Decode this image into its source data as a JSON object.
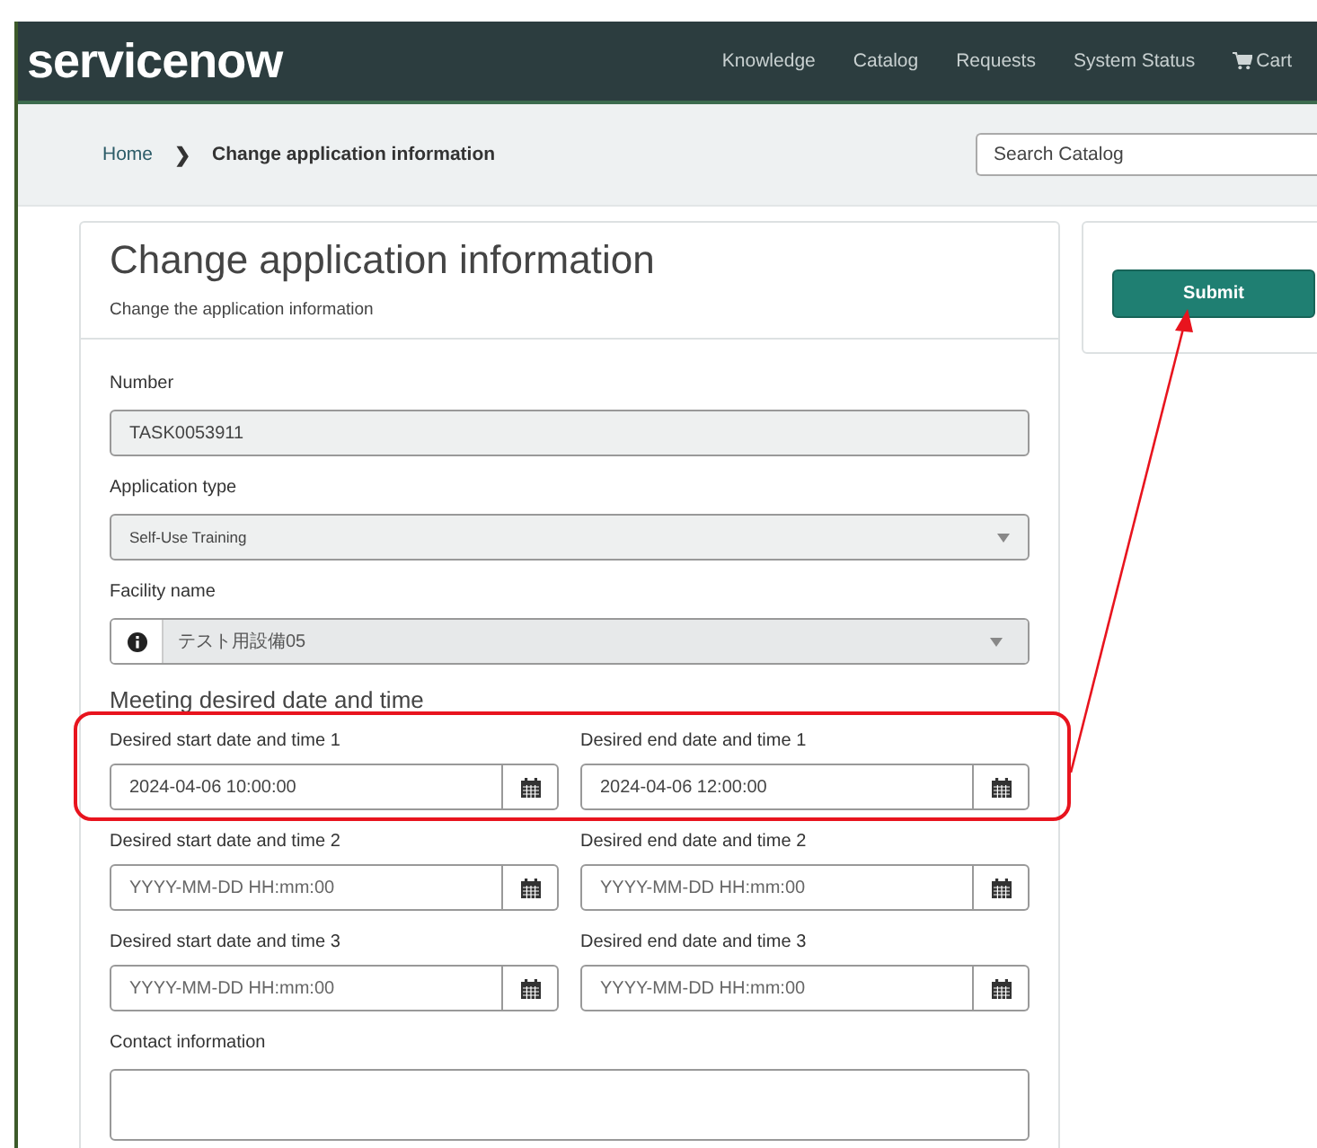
{
  "header": {
    "logo": "servicenow",
    "nav": [
      {
        "label": "Knowledge",
        "kind": "link"
      },
      {
        "label": "Catalog",
        "kind": "link"
      },
      {
        "label": "Requests",
        "kind": "link"
      },
      {
        "label": "System Status",
        "kind": "link"
      },
      {
        "label": "Cart",
        "kind": "cart"
      }
    ]
  },
  "breadcrumb": {
    "home": "Home",
    "separator": "❯",
    "current": "Change application information"
  },
  "search": {
    "placeholder": "Search Catalog"
  },
  "form": {
    "title": "Change application information",
    "subtitle": "Change the application information",
    "fields": [
      {
        "kind": "text",
        "label": "Number",
        "value": "TASK0053911",
        "disabled": true
      },
      {
        "kind": "select",
        "label": "Application type",
        "value": "Self-Use Training",
        "disabled": true
      },
      {
        "kind": "reference",
        "label": "Facility name",
        "value": "テスト用設備05",
        "disabled": true
      }
    ],
    "section": "Meeting desired date and time",
    "date_rows": [
      {
        "start": {
          "label": "Desired start date and time 1",
          "value": "2024-04-06 10:00:00"
        },
        "end": {
          "label": "Desired end date and time 1",
          "value": "2024-04-06 12:00:00"
        }
      },
      {
        "start": {
          "label": "Desired start date and time 2",
          "placeholder": "YYYY-MM-DD HH:mm:00"
        },
        "end": {
          "label": "Desired end date and time 2",
          "placeholder": "YYYY-MM-DD HH:mm:00"
        }
      },
      {
        "start": {
          "label": "Desired start date and time 3",
          "placeholder": "YYYY-MM-DD HH:mm:00"
        },
        "end": {
          "label": "Desired end date and time 3",
          "placeholder": "YYYY-MM-DD HH:mm:00"
        }
      }
    ],
    "contact": {
      "label": "Contact information"
    }
  },
  "submit": {
    "label": "Submit"
  }
}
